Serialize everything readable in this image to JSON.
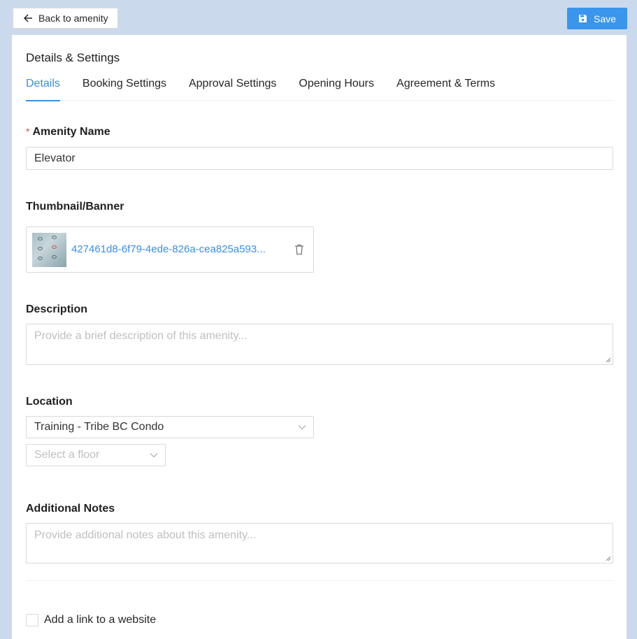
{
  "header": {
    "back_label": "Back to amenity",
    "save_label": "Save"
  },
  "panel": {
    "title": "Details & Settings",
    "tabs": [
      {
        "label": "Details",
        "active": true
      },
      {
        "label": "Booking Settings",
        "active": false
      },
      {
        "label": "Approval Settings",
        "active": false
      },
      {
        "label": "Opening Hours",
        "active": false
      },
      {
        "label": "Agreement & Terms",
        "active": false
      }
    ]
  },
  "form": {
    "amenity_name": {
      "required_mark": "*",
      "label": "Amenity Name",
      "value": "Elevator"
    },
    "thumbnail": {
      "label": "Thumbnail/Banner",
      "file_name": "427461d8-6f79-4ede-826a-cea825a593..."
    },
    "description": {
      "label": "Description",
      "placeholder": "Provide a brief description of this amenity..."
    },
    "location": {
      "label": "Location",
      "selected": "Training - Tribe BC Condo",
      "floor_placeholder": "Select a floor"
    },
    "additional_notes": {
      "label": "Additional Notes",
      "placeholder": "Provide additional notes about this amenity..."
    },
    "website_link": {
      "label": "Add a link to a website",
      "checked": false
    }
  },
  "colors": {
    "accent": "#3a8ee6",
    "save_button": "#3a95ec",
    "background": "#cbd9ec",
    "required": "#e04b4b"
  },
  "icons": [
    "arrow-left-icon",
    "save-disk-icon",
    "trash-icon",
    "chevron-down-icon",
    "resize-grip-icon"
  ]
}
